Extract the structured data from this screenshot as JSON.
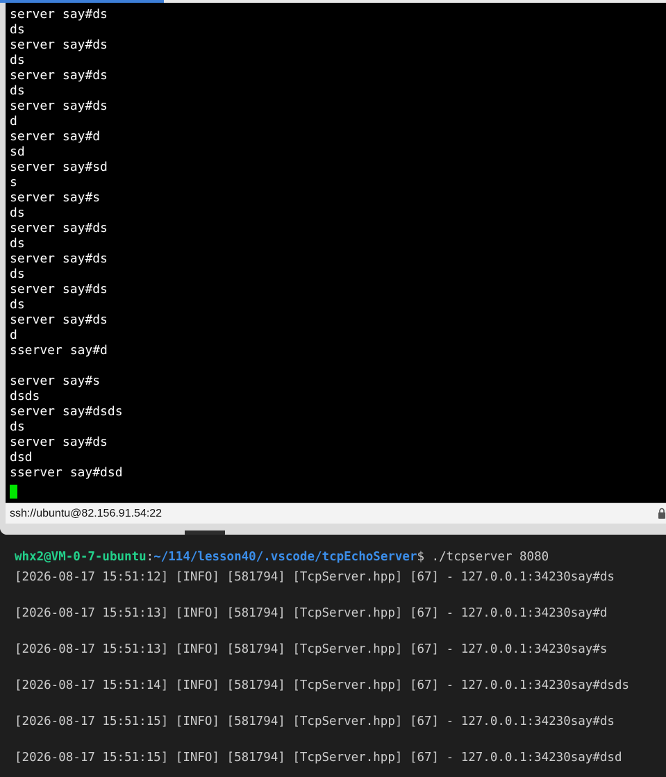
{
  "ssh_window": {
    "output_lines": [
      "server say#ds",
      "ds",
      "server say#ds",
      "ds",
      "server say#ds",
      "ds",
      "server say#ds",
      "d",
      "server say#d",
      "sd",
      "server say#sd",
      "s",
      "server say#s",
      "ds",
      "server say#ds",
      "ds",
      "server say#ds",
      "ds",
      "server say#ds",
      "ds",
      "server say#ds",
      "d",
      "sserver say#d",
      "",
      "server say#s",
      "dsds",
      "server say#dsds",
      "ds",
      "server say#ds",
      "dsd",
      "sserver say#dsd"
    ],
    "status_address": "ssh://ubuntu@82.156.91.54:22",
    "cursor_color": "#00e600",
    "icons": {
      "status_lock": "lock-icon"
    }
  },
  "local_terminal": {
    "prompt": {
      "user_host": "whx2@VM-0-7-ubuntu",
      "colon": ":",
      "path": "~/114/lesson40/.vscode/tcpEchoServer",
      "dollar": "$",
      "command": " ./tcpserver 8080"
    },
    "log_lines": [
      "[2026-08-17 15:51:12] [INFO] [581794] [TcpServer.hpp] [67] - 127.0.0.1:34230say#ds",
      "[2026-08-17 15:51:13] [INFO] [581794] [TcpServer.hpp] [67] - 127.0.0.1:34230say#d",
      "[2026-08-17 15:51:13] [INFO] [581794] [TcpServer.hpp] [67] - 127.0.0.1:34230say#s",
      "[2026-08-17 15:51:14] [INFO] [581794] [TcpServer.hpp] [67] - 127.0.0.1:34230say#dsds",
      "[2026-08-17 15:51:15] [INFO] [581794] [TcpServer.hpp] [67] - 127.0.0.1:34230say#ds",
      "[2026-08-17 15:51:15] [INFO] [581794] [TcpServer.hpp] [67] - 127.0.0.1:34230say#dsd"
    ],
    "colors": {
      "user_host": "#23d18b",
      "path": "#3b8eea",
      "text": "#cccccc",
      "background": "#1e1e1e"
    }
  }
}
